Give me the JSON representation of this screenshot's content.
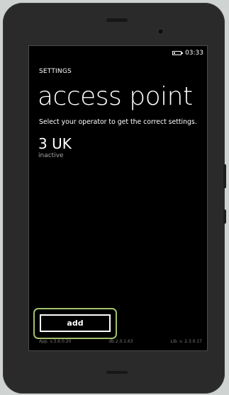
{
  "status_bar": {
    "time": "03:33"
  },
  "app": {
    "title": "SETTINGS"
  },
  "page": {
    "title": "access point",
    "subtitle": "Select your operator to get the correct settings."
  },
  "operators": [
    {
      "name": "3 UK",
      "status": "inactive"
    }
  ],
  "actions": {
    "add_label": "add"
  },
  "footer": {
    "app_version": "App. v.3.6.0.20",
    "db_version": "db.2.0.1.63",
    "lib_version": "Lib. v. 2.3.0.17"
  },
  "colors": {
    "screen_background": "#000000",
    "text": "#ffffff",
    "secondary_text": "#a6a6a6",
    "highlight": "#a3bf6c",
    "device_body": "#2a2a2a",
    "page_background": "#cfd3d1"
  },
  "icons": [
    "battery-icon",
    "camera-icon",
    "earpiece-icon"
  ]
}
